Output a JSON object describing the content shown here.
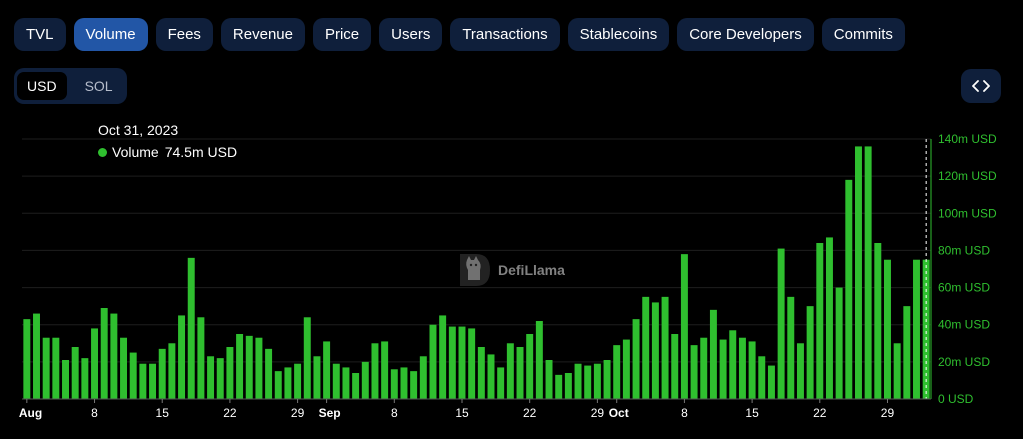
{
  "tabs": [
    {
      "label": "TVL",
      "active": false
    },
    {
      "label": "Volume",
      "active": true
    },
    {
      "label": "Fees",
      "active": false
    },
    {
      "label": "Revenue",
      "active": false
    },
    {
      "label": "Price",
      "active": false
    },
    {
      "label": "Users",
      "active": false
    },
    {
      "label": "Transactions",
      "active": false
    },
    {
      "label": "Stablecoins",
      "active": false
    },
    {
      "label": "Core Developers",
      "active": false
    },
    {
      "label": "Commits",
      "active": false
    }
  ],
  "unit_toggle": {
    "usd": "USD",
    "sol": "SOL",
    "selected": "USD"
  },
  "tooltip": {
    "date": "Oct 31, 2023",
    "series": "Volume",
    "value": "74.5m USD"
  },
  "watermark": {
    "text": "DefiLlama"
  },
  "colors": {
    "bar": "#2fbf2f",
    "tab_bg": "#0f1f3b",
    "tab_active": "#2256a6",
    "grid": "#1e1e1e"
  },
  "icons": {
    "embed": "code-brackets-icon",
    "logo": "llama-logo-icon"
  },
  "chart_data": {
    "type": "bar",
    "x_start": "2023-08-01",
    "x_end": "2023-10-31",
    "xticks": [
      "Aug",
      "8",
      "15",
      "22",
      "29",
      "Sep",
      "8",
      "15",
      "22",
      "29",
      "Oct",
      "8",
      "15",
      "22",
      "29"
    ],
    "yticks": [
      "0 USD",
      "20m USD",
      "40m USD",
      "60m USD",
      "80m USD",
      "100m USD",
      "120m USD",
      "140m USD"
    ],
    "ylim": [
      0,
      140
    ],
    "y_axis_position": "right",
    "grid": true,
    "highlighted": "2023-10-31",
    "series": [
      {
        "name": "Volume",
        "unit": "m USD",
        "values": [
          43,
          46,
          33,
          33,
          21,
          28,
          22,
          38,
          49,
          46,
          33,
          25,
          19,
          19,
          27,
          30,
          45,
          76,
          44,
          23,
          22,
          28,
          35,
          34,
          33,
          27,
          15,
          17,
          19,
          44,
          23,
          31,
          19,
          17,
          14,
          20,
          30,
          31,
          16,
          17,
          15,
          23,
          40,
          45,
          39,
          39,
          38,
          28,
          24,
          17,
          30,
          28,
          35,
          42,
          21,
          13,
          14,
          19,
          18,
          19,
          21,
          29,
          32,
          43,
          55,
          52,
          55,
          35,
          78,
          29,
          33,
          48,
          32,
          37,
          33,
          31,
          23,
          18,
          81,
          55,
          30,
          50,
          84,
          87,
          60,
          118,
          136,
          136,
          84,
          75,
          30,
          50,
          75,
          75
        ]
      }
    ]
  }
}
